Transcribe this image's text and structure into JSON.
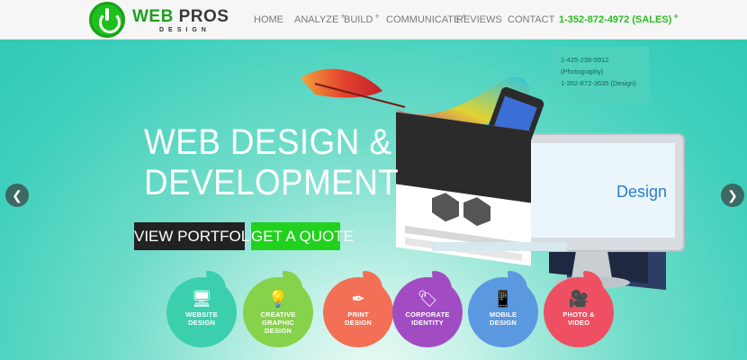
{
  "header": {
    "logo": {
      "word1": "WEB",
      "word2": "PROS",
      "sub": "DESIGN"
    },
    "nav": [
      {
        "label": "HOME",
        "plus": ""
      },
      {
        "label": "ANALYZE",
        "plus": "+"
      },
      {
        "label": "BUILD",
        "plus": "+"
      },
      {
        "label": "COMMUNICATE",
        "plus": "+"
      },
      {
        "label": "REVIEWS",
        "plus": ""
      },
      {
        "label": "CONTACT",
        "plus": ""
      }
    ],
    "phone": {
      "label": "1-352-872-4972 (SALES)",
      "plus": "+"
    }
  },
  "popup": {
    "lines": [
      "1-425-239-5912",
      "(Photography)",
      "1-352-872-3635 (Design)"
    ]
  },
  "hero": {
    "title_line1": "WEB DESIGN &",
    "title_line2": "DEVELOPMENT",
    "btn_portfolio": "VIEW PORTFOLIO",
    "btn_quote": "GET A QUOTE",
    "arrow_left": "❮",
    "arrow_right": "❯"
  },
  "services": [
    {
      "line1": "WEBSITE",
      "line2": "DESIGN",
      "line3": "",
      "color": "#3bcfae",
      "icon": "monitor-icon",
      "glyph": "🖥"
    },
    {
      "line1": "CREATIVE",
      "line2": "GRAPHIC",
      "line3": "DESIGN",
      "color": "#86d24a",
      "icon": "lightbulb-icon",
      "glyph": "💡"
    },
    {
      "line1": "PRINT",
      "line2": "DESIGN",
      "line3": "",
      "color": "#f36f55",
      "icon": "pen-icon",
      "glyph": "✒"
    },
    {
      "line1": "CORPORATE",
      "line2": "IDENTITY",
      "line3": "",
      "color": "#a24cc4",
      "icon": "tag-icon",
      "glyph": "🏷"
    },
    {
      "line1": "MOBILE",
      "line2": "DESIGN",
      "line3": "",
      "color": "#5a98e0",
      "icon": "smartphone-icon",
      "glyph": "📱"
    },
    {
      "line1": "PHOTO &",
      "line2": "VIDEO",
      "line3": "",
      "color": "#ef4f62",
      "icon": "camera-icon",
      "glyph": "🎥"
    }
  ],
  "colors": {
    "brand_green": "#22d11e",
    "hero_teal": "#3ed0bc",
    "dark": "#222222"
  }
}
